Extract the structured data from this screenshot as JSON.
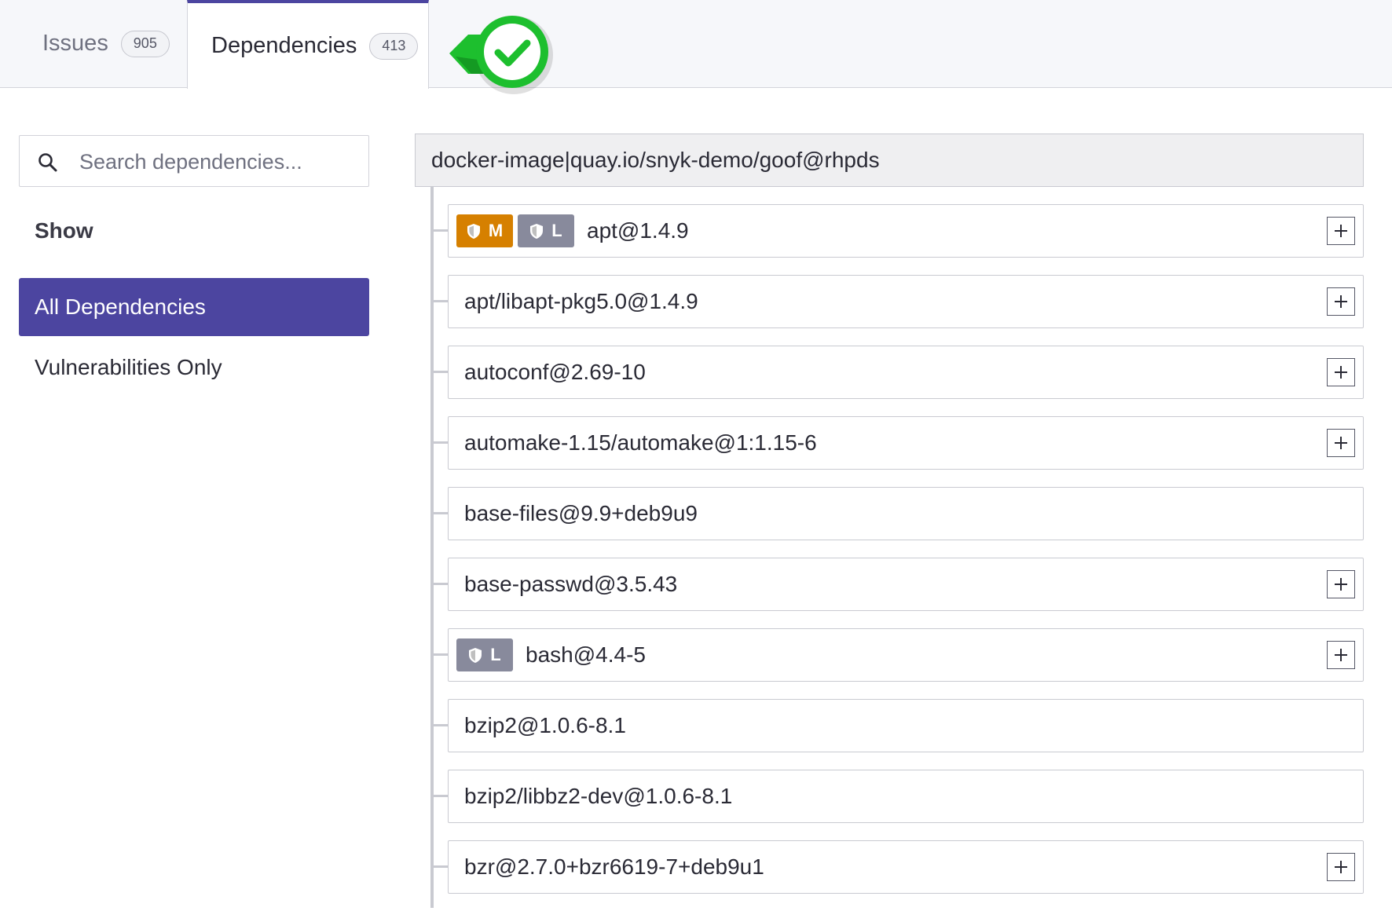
{
  "tabs": [
    {
      "label": "Issues",
      "count": "905"
    },
    {
      "label": "Dependencies",
      "count": "413"
    }
  ],
  "status_icon": "check-icon",
  "colors": {
    "accent": "#4c45a0",
    "severity_medium": "#d68000",
    "severity_low": "#888a9c",
    "status_green": "#1dbf2e"
  },
  "sidebar": {
    "search_placeholder": "Search dependencies...",
    "show_heading": "Show",
    "filters": [
      {
        "label": "All Dependencies",
        "selected": true
      },
      {
        "label": "Vulnerabilities Only",
        "selected": false
      }
    ]
  },
  "tree": {
    "root": "docker-image|quay.io/snyk-demo/goof@rhpds",
    "dependencies": [
      {
        "name": "apt@1.4.9",
        "badges": [
          "M",
          "L"
        ],
        "expandable": true
      },
      {
        "name": "apt/libapt-pkg5.0@1.4.9",
        "badges": [],
        "expandable": true
      },
      {
        "name": "autoconf@2.69-10",
        "badges": [],
        "expandable": true
      },
      {
        "name": "automake-1.15/automake@1:1.15-6",
        "badges": [],
        "expandable": true
      },
      {
        "name": "base-files@9.9+deb9u9",
        "badges": [],
        "expandable": false
      },
      {
        "name": "base-passwd@3.5.43",
        "badges": [],
        "expandable": true
      },
      {
        "name": "bash@4.4-5",
        "badges": [
          "L"
        ],
        "expandable": true
      },
      {
        "name": "bzip2@1.0.6-8.1",
        "badges": [],
        "expandable": false
      },
      {
        "name": "bzip2/libbz2-dev@1.0.6-8.1",
        "badges": [],
        "expandable": false
      },
      {
        "name": "bzr@2.7.0+bzr6619-7+deb9u1",
        "badges": [],
        "expandable": true
      }
    ]
  }
}
